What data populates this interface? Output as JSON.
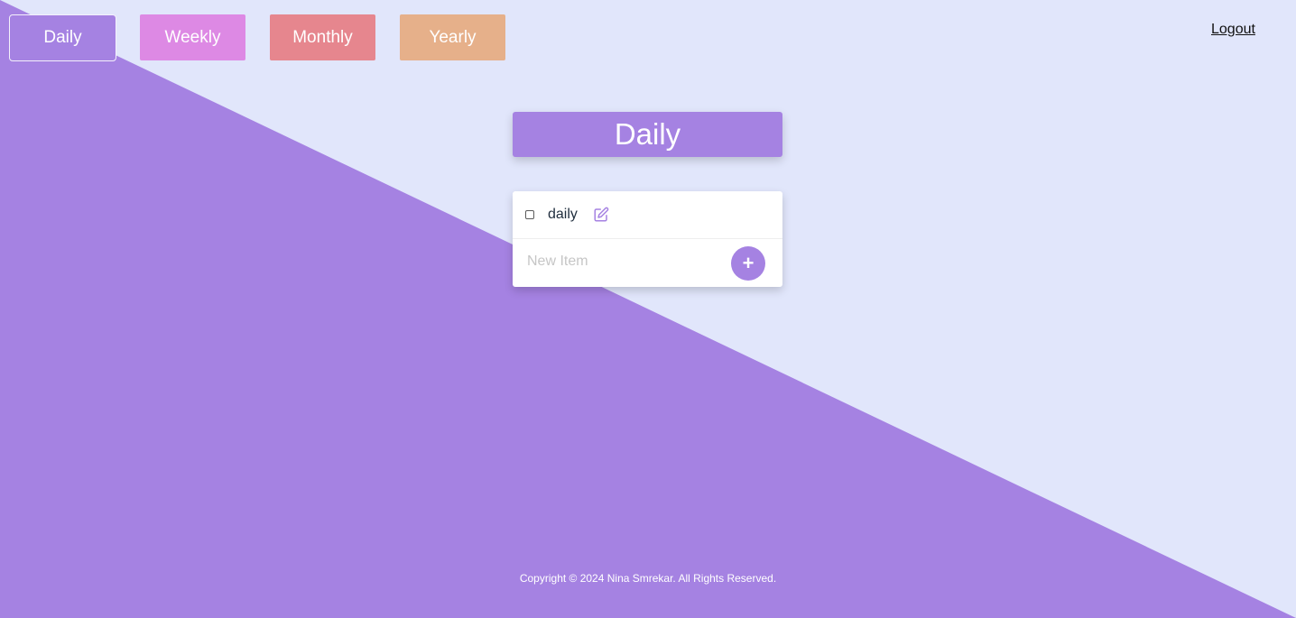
{
  "nav": {
    "tabs": [
      {
        "label": "Daily",
        "color": "#a582e2",
        "active": true
      },
      {
        "label": "Weekly",
        "color": "#dd89e4"
      },
      {
        "label": "Monthly",
        "color": "#e6868e"
      },
      {
        "label": "Yearly",
        "color": "#e6b08a"
      }
    ],
    "logout_label": "Logout"
  },
  "list": {
    "title": "Daily",
    "items": [
      {
        "text": "daily",
        "checked": false,
        "icon": "edit-icon"
      }
    ],
    "new_item_placeholder": "New Item",
    "add_label": "+"
  },
  "footer": {
    "text": "Copyright © 2024 Nina Smrekar. All Rights Reserved."
  },
  "colors": {
    "accent": "#a582e2",
    "background": "#e1e6fb"
  }
}
